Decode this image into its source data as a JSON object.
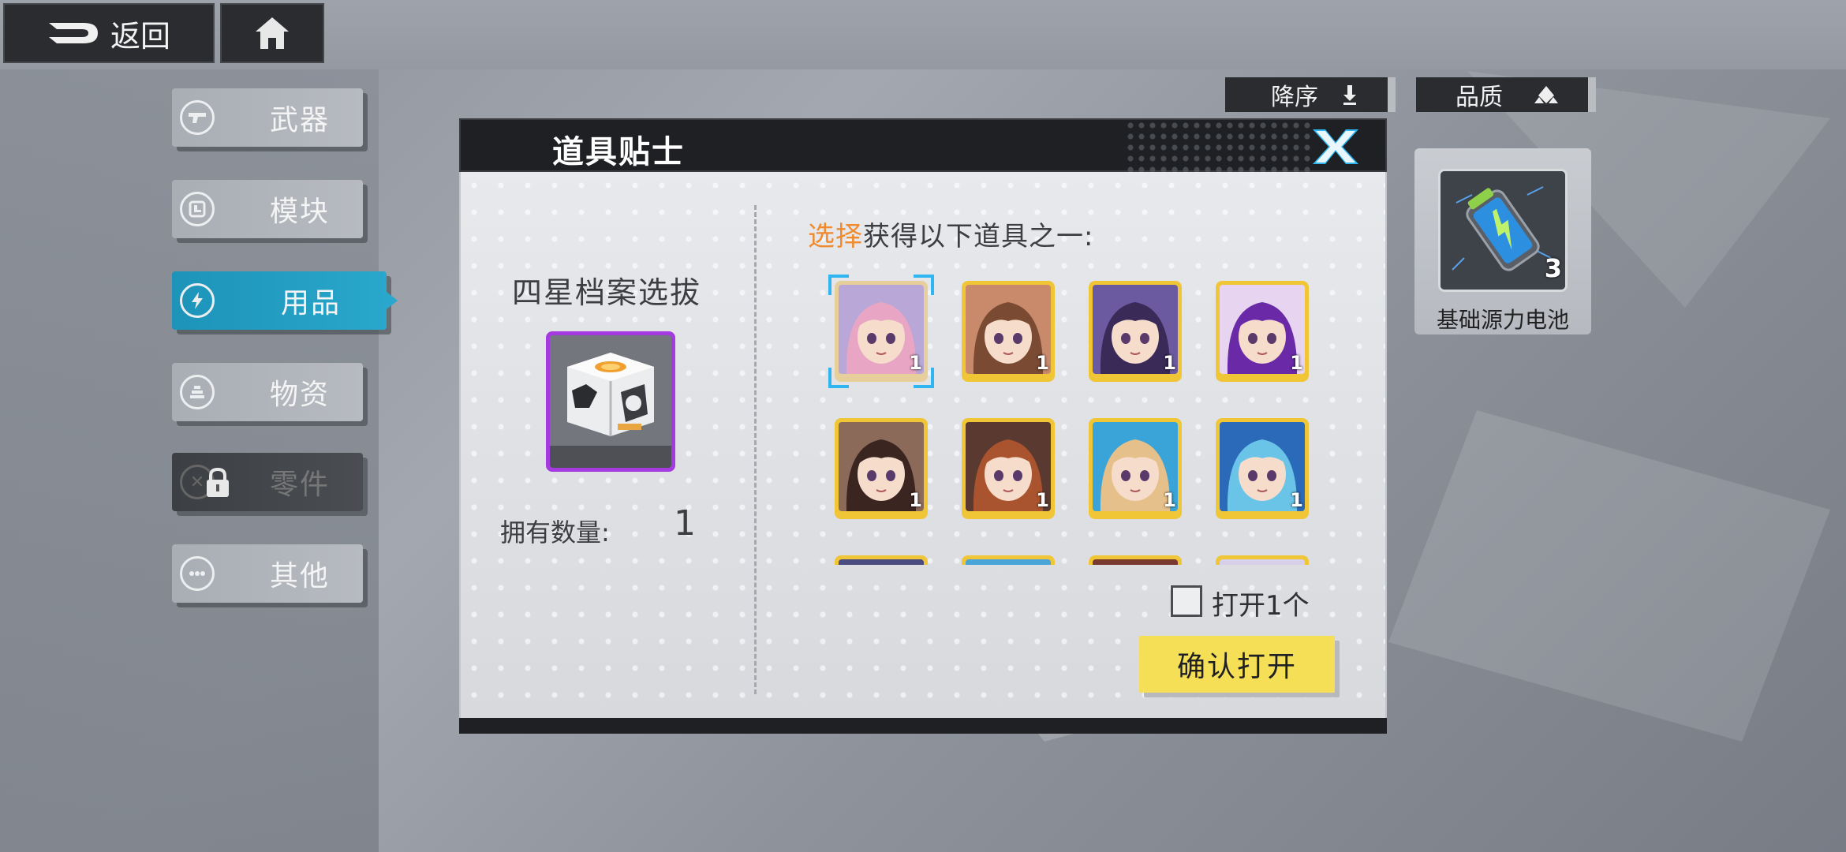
{
  "top_bar": {
    "back_label": "返回",
    "home_icon": "home-icon"
  },
  "side_tabs": [
    {
      "label": "武器",
      "icon": "gun-icon",
      "state": "normal"
    },
    {
      "label": "模块",
      "icon": "module-icon",
      "state": "normal"
    },
    {
      "label": "用品",
      "icon": "lightning-icon",
      "state": "active"
    },
    {
      "label": "物资",
      "icon": "supply-icon",
      "state": "normal"
    },
    {
      "label": "零件",
      "icon": "parts-icon",
      "state": "locked"
    },
    {
      "label": "其他",
      "icon": "more-icon",
      "state": "normal"
    }
  ],
  "sort": {
    "order_label": "降序",
    "quality_label": "品质"
  },
  "inventory_item": {
    "name": "基础源力电池",
    "count": "3"
  },
  "modal": {
    "title": "道具贴士",
    "box_name": "四星档案选拔",
    "own_label": "拥有数量:",
    "own_value": "1",
    "choose_highlight": "选择",
    "choose_rest": "获得以下道具之一:",
    "open_one_label": "打开1个",
    "confirm_label": "确认打开",
    "rewards": [
      {
        "qty": "1",
        "selected": true,
        "hair": "#e8a6c4",
        "bg": "#b9a7d8"
      },
      {
        "qty": "1",
        "selected": false,
        "hair": "#7a4a32",
        "bg": "#c98a6b"
      },
      {
        "qty": "1",
        "selected": false,
        "hair": "#3a2a58",
        "bg": "#6c5aa0"
      },
      {
        "qty": "1",
        "selected": false,
        "hair": "#6a2aa8",
        "bg": "#e6d4f0"
      },
      {
        "qty": "1",
        "selected": false,
        "hair": "#3b2520",
        "bg": "#8c6a5a"
      },
      {
        "qty": "1",
        "selected": false,
        "hair": "#a9542e",
        "bg": "#5a3a30"
      },
      {
        "qty": "1",
        "selected": false,
        "hair": "#e6c08a",
        "bg": "#3aa4d8"
      },
      {
        "qty": "1",
        "selected": false,
        "hair": "#6ac4e8",
        "bg": "#2a6ab8"
      },
      {
        "qty": "",
        "selected": false,
        "hair": "#6a6cb0",
        "bg": "#4a4c80"
      },
      {
        "qty": "",
        "selected": false,
        "hair": "#e88a6a",
        "bg": "#4aa4d8"
      },
      {
        "qty": "",
        "selected": false,
        "hair": "#a84a3a",
        "bg": "#7a3a30"
      },
      {
        "qty": "",
        "selected": false,
        "hair": "#8a7ab0",
        "bg": "#d8d0e8"
      }
    ]
  },
  "colors": {
    "accent_blue": "#2aa7cc",
    "highlight_orange": "#f08a2c",
    "confirm_yellow": "#f4df56",
    "box_purple": "#a43adf",
    "reward_gold": "#f0c536"
  }
}
